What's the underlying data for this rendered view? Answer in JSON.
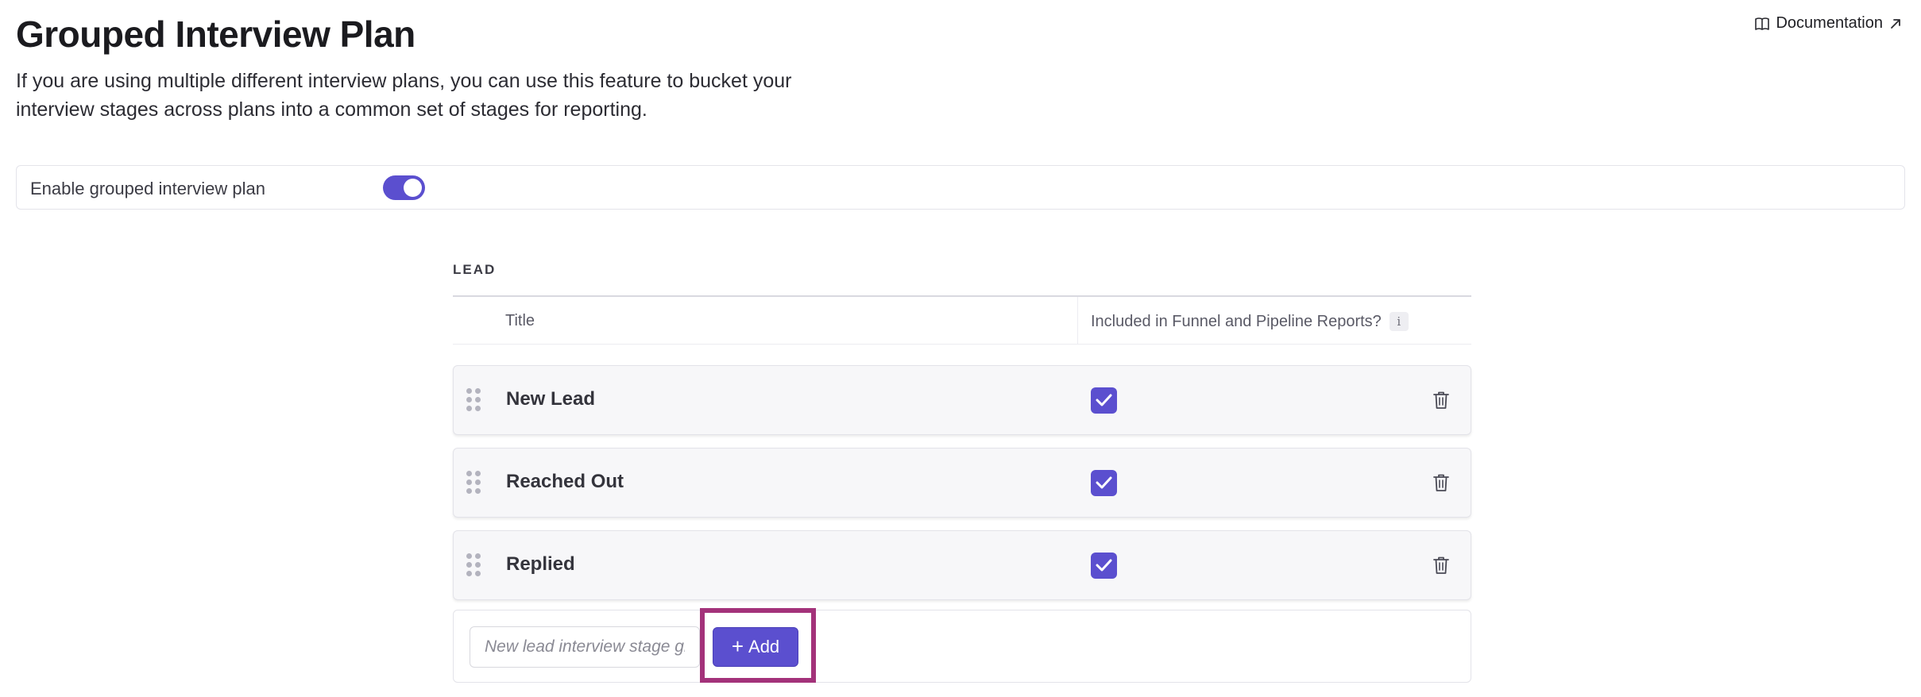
{
  "header": {
    "title": "Grouped Interview Plan",
    "description": "If you are using multiple different interview plans, you can use this feature to bucket your interview stages across plans into a common set of stages for reporting.",
    "doc_link": {
      "label": "Documentation",
      "icon": "book-icon",
      "trailing_icon": "external-arrow-icon"
    }
  },
  "toggle": {
    "label": "Enable grouped interview plan",
    "enabled": true
  },
  "section": {
    "label": "LEAD",
    "columns": {
      "title": "Title",
      "included": "Included in Funnel and Pipeline Reports?",
      "info_glyph": "i"
    },
    "stages": [
      {
        "title": "New Lead",
        "included": true
      },
      {
        "title": "Reached Out",
        "included": true
      },
      {
        "title": "Replied",
        "included": true
      }
    ],
    "add": {
      "placeholder": "New lead interview stage group",
      "plus_glyph": "+",
      "button_label": "Add"
    }
  },
  "colors": {
    "accent": "#5b4fcf",
    "highlight": "#a3327a"
  }
}
